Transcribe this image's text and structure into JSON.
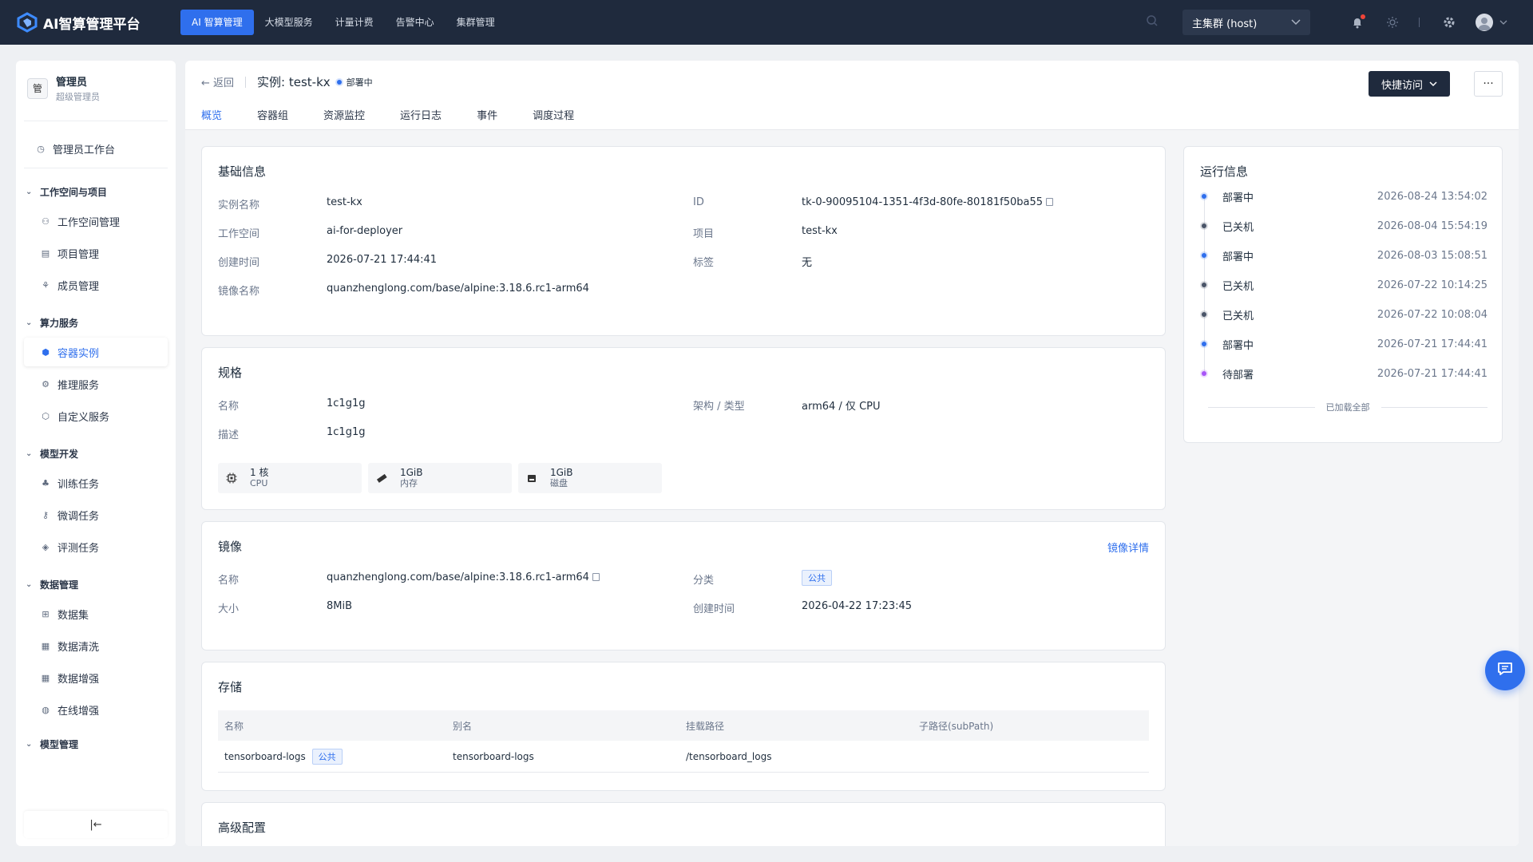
{
  "app": {
    "title": "AI智算管理平台"
  },
  "topnav": [
    {
      "label": "AI 智算管理",
      "active": true
    },
    {
      "label": "大模型服务"
    },
    {
      "label": "计量计费"
    },
    {
      "label": "告警中心"
    },
    {
      "label": "集群管理"
    }
  ],
  "cluster": {
    "selected": "主集群 (host)"
  },
  "user": {
    "badge": "管",
    "name": "管理员",
    "role": "超级管理员"
  },
  "sidebar": {
    "workbench": "管理员工作台",
    "groups": [
      {
        "label": "工作空间与项目",
        "items": [
          "工作空间管理",
          "项目管理",
          "成员管理"
        ]
      },
      {
        "label": "算力服务",
        "items": [
          "容器实例",
          "推理服务",
          "自定义服务"
        ]
      },
      {
        "label": "模型开发",
        "items": [
          "训练任务",
          "微调任务",
          "评测任务"
        ]
      },
      {
        "label": "数据管理",
        "items": [
          "数据集",
          "数据清洗",
          "数据增强",
          "在线增强"
        ]
      },
      {
        "label": "模型管理",
        "items": []
      }
    ],
    "collapse": "|←"
  },
  "header": {
    "back": "← 返回",
    "title": "实例: test-kx",
    "status": "部署中",
    "quick_access": "快捷访问",
    "more": "···"
  },
  "tabs": [
    "概览",
    "容器组",
    "资源监控",
    "运行日志",
    "事件",
    "调度过程"
  ],
  "basic": {
    "title": "基础信息",
    "name_k": "实例名称",
    "name_v": "test-kx",
    "id_k": "ID",
    "id_v": "tk-0-90095104-1351-4f3d-80fe-80181f50ba55",
    "ws_k": "工作空间",
    "ws_v": "ai-for-deployer",
    "proj_k": "项目",
    "proj_v": "test-kx",
    "created_k": "创建时间",
    "created_v": "2026-07-21 17:44:41",
    "tag_k": "标签",
    "tag_v": "无",
    "image_k": "镜像名称",
    "image_v": "quanzhenglong.com/base/alpine:3.18.6.rc1-arm64"
  },
  "spec": {
    "title": "规格",
    "name_k": "名称",
    "name_v": "1c1g1g",
    "arch_k": "架构 / 类型",
    "arch_v": "arm64 / 仅 CPU",
    "desc_k": "描述",
    "desc_v": "1c1g1g",
    "chips": [
      {
        "value": "1 核",
        "label": "CPU"
      },
      {
        "value": "1GiB",
        "label": "内存"
      },
      {
        "value": "1GiB",
        "label": "磁盘"
      }
    ]
  },
  "image": {
    "title": "镜像",
    "detail_link": "镜像详情",
    "name_k": "名称",
    "name_v": "quanzhenglong.com/base/alpine:3.18.6.rc1-arm64",
    "cat_k": "分类",
    "cat_v": "公共",
    "size_k": "大小",
    "size_v": "8MiB",
    "created_k": "创建时间",
    "created_v": "2026-04-22 17:23:45"
  },
  "storage": {
    "title": "存储",
    "columns": [
      "名称",
      "别名",
      "挂载路径",
      "子路径(subPath)"
    ],
    "rows": [
      {
        "name": "tensorboard-logs",
        "tag": "公共",
        "alias": "tensorboard-logs",
        "path": "/tensorboard_logs",
        "sub": ""
      }
    ]
  },
  "advanced": {
    "title": "高级配置"
  },
  "run": {
    "title": "运行信息",
    "events": [
      {
        "status": "部署中",
        "time": "2026-08-24 13:54:02",
        "color": "#2f6fed"
      },
      {
        "status": "已关机",
        "time": "2026-08-04 15:54:19",
        "color": "#4a5568"
      },
      {
        "status": "部署中",
        "time": "2026-08-03 15:08:51",
        "color": "#2f6fed"
      },
      {
        "status": "已关机",
        "time": "2026-07-22 10:14:25",
        "color": "#4a5568"
      },
      {
        "status": "已关机",
        "time": "2026-07-22 10:08:04",
        "color": "#4a5568"
      },
      {
        "status": "部署中",
        "time": "2026-07-21 17:44:41",
        "color": "#2f6fed"
      },
      {
        "status": "待部署",
        "time": "2026-07-21 17:44:41",
        "color": "#a855f7"
      }
    ],
    "end": "已加载全部"
  },
  "colors": {
    "accent": "#2f6fed",
    "topbar": "#1f2a3d"
  }
}
